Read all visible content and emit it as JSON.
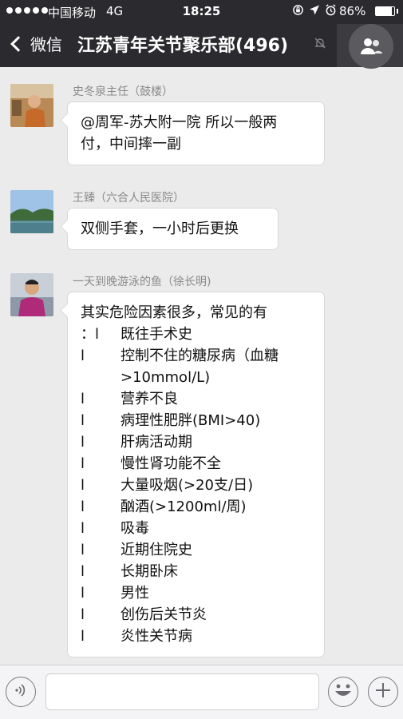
{
  "status_bar": {
    "carrier": "中国移动",
    "network": "4G",
    "time": "18:25",
    "battery_percent": "86%",
    "battery_level": 0.86,
    "icons": [
      "rotation-lock-icon",
      "location-arrow-icon",
      "alarm-clock-icon"
    ]
  },
  "nav": {
    "back_label": "微信",
    "title": "江苏青年关节聚乐部(496)",
    "muted_icon": "bell-muted-icon",
    "group_icon": "group-members-icon"
  },
  "messages": [
    {
      "sender": "史冬泉主任（鼓楼）",
      "lines": [
        "@周军-苏大附一院 所以一般两",
        "付，中间摔一副"
      ]
    },
    {
      "sender": "王臻（六合人民医院）",
      "lines": [
        "双侧手套，一小时后更换"
      ]
    },
    {
      "sender": "一天到晚游泳的鱼（徐长明)",
      "intro": "其实危险因素很多，常见的有",
      "first_item": {
        "mark": "：l",
        "text": "既往手术史"
      },
      "items": [
        {
          "mark": "l",
          "text": "控制不住的糖尿病（血糖>10mmol/L)"
        },
        {
          "mark": "l",
          "text": "营养不良"
        },
        {
          "mark": "l",
          "text": "病理性肥胖(BMI>40)"
        },
        {
          "mark": "l",
          "text": "肝病活动期"
        },
        {
          "mark": "l",
          "text": "慢性肾功能不全"
        },
        {
          "mark": "l",
          "text": "大量吸烟(>20支/日)"
        },
        {
          "mark": "l",
          "text": "酗酒(>1200ml/周)"
        },
        {
          "mark": "l",
          "text": "吸毒"
        },
        {
          "mark": "l",
          "text": "近期住院史"
        },
        {
          "mark": "l",
          "text": "长期卧床"
        },
        {
          "mark": "l",
          "text": "男性"
        },
        {
          "mark": "l",
          "text": "创伤后关节炎"
        },
        {
          "mark": "l",
          "text": "炎性关节病"
        }
      ]
    }
  ],
  "input_bar": {
    "voice_icon": "voice-input-icon",
    "emoji_icon": "emoji-icon",
    "plus_icon": "plus-icon"
  },
  "colors": {
    "nav_background": "#2a2a2f",
    "chat_background": "#ebebeb",
    "bubble": "#ffffff"
  }
}
